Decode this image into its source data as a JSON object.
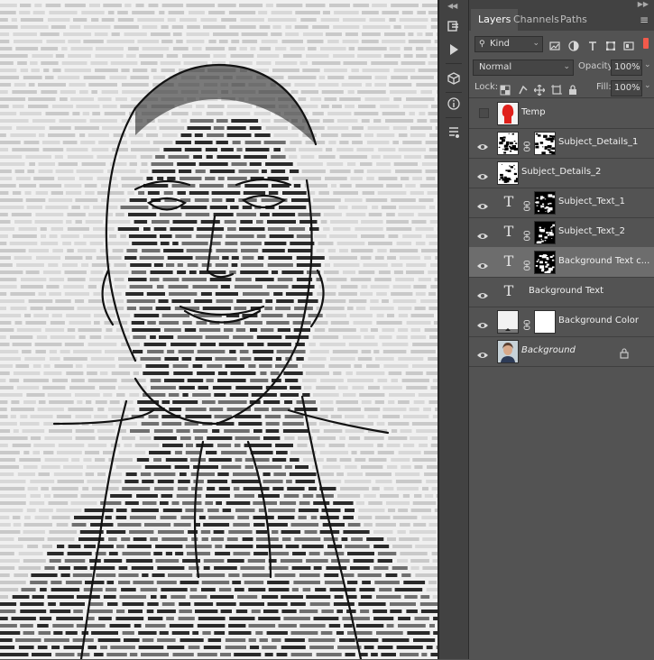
{
  "panel": {
    "tabs": [
      {
        "label": "Layers",
        "active": true
      },
      {
        "label": "Channels",
        "active": false
      },
      {
        "label": "Paths",
        "active": false
      }
    ],
    "filter": {
      "kind_label": "Kind"
    },
    "blend": {
      "mode": "Normal",
      "opacity_label": "Opacity:",
      "opacity_value": "100%"
    },
    "lock": {
      "lock_label": "Lock:",
      "fill_label": "Fill:",
      "fill_value": "100%"
    },
    "layers": [
      {
        "name": "Temp",
        "visible": false,
        "type": "raster-red",
        "linked_mask": false,
        "selected": false,
        "italic": false,
        "locked": false
      },
      {
        "name": "Subject_Details_1",
        "visible": true,
        "type": "raster-mask",
        "linked_mask": true,
        "selected": false,
        "italic": false,
        "locked": false
      },
      {
        "name": "Subject_Details_2",
        "visible": true,
        "type": "raster",
        "linked_mask": false,
        "selected": false,
        "italic": false,
        "locked": false
      },
      {
        "name": "Subject_Text_1",
        "visible": true,
        "type": "text-mask",
        "linked_mask": true,
        "selected": false,
        "italic": false,
        "locked": false
      },
      {
        "name": "Subject_Text_2",
        "visible": true,
        "type": "text-mask",
        "linked_mask": true,
        "selected": false,
        "italic": false,
        "locked": false
      },
      {
        "name": "Background Text c...",
        "visible": true,
        "type": "text-mask",
        "linked_mask": true,
        "selected": true,
        "italic": false,
        "locked": false
      },
      {
        "name": "Background Text",
        "visible": true,
        "type": "text",
        "linked_mask": false,
        "selected": false,
        "italic": false,
        "locked": false
      },
      {
        "name": "Background Color",
        "visible": true,
        "type": "fill-mask",
        "linked_mask": true,
        "selected": false,
        "italic": false,
        "locked": false
      },
      {
        "name": "Background",
        "visible": true,
        "type": "photo",
        "linked_mask": false,
        "selected": false,
        "italic": true,
        "locked": true
      }
    ]
  },
  "colors": {
    "panel_bg": "#535353",
    "panel_dark": "#424242",
    "selected_row": "#6d6d6d",
    "temp_red": "#e0201b",
    "toggle_red": "#f25a4b"
  },
  "icons": {
    "toolstrip": [
      "history-icon",
      "play-icon",
      "3d-cube-icon",
      "info-icon",
      "properties-icon"
    ],
    "filter": [
      "search-icon",
      "pixel-filter-icon",
      "adjustment-filter-icon",
      "type-filter-icon",
      "shape-filter-icon",
      "smart-object-filter-icon",
      "filter-toggle-icon"
    ],
    "lock": [
      "lock-transparent-icon",
      "lock-image-icon",
      "lock-position-icon",
      "lock-artboard-icon",
      "lock-all-icon"
    ]
  }
}
